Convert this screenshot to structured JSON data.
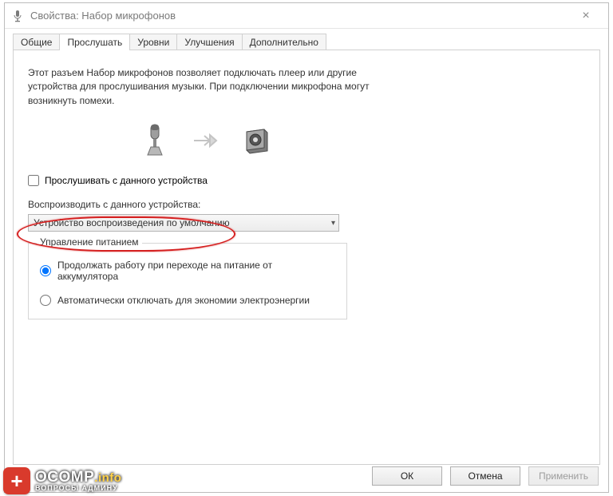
{
  "title": "Свойства: Набор микрофонов",
  "tabs": [
    "Общие",
    "Прослушать",
    "Уровни",
    "Улучшения",
    "Дополнительно"
  ],
  "active_tab_index": 1,
  "description": "Этот разъем Набор микрофонов позволяет подключать плеер или другие устройства для прослушивания музыки. При подключении микрофона могут возникнуть помехи.",
  "listen_checkbox": {
    "label": "Прослушивать с данного устройства",
    "checked": false
  },
  "playback_label": "Воспроизводить с данного устройства:",
  "playback_selected": "Устройство воспроизведения по умолчанию",
  "power_group": {
    "legend": "Управление питанием",
    "option_continue": "Продолжать работу при переходе на питание от аккумулятора",
    "option_auto_off": "Автоматически отключать для экономии электроэнергии",
    "selected": 0
  },
  "buttons": {
    "ok": "ОК",
    "cancel": "Отмена",
    "apply": "Применить"
  },
  "watermark": {
    "brand_main": "OCOMP",
    "brand_suffix": ".info",
    "subtitle": "ВОПРОСЫ АДМИНУ"
  }
}
